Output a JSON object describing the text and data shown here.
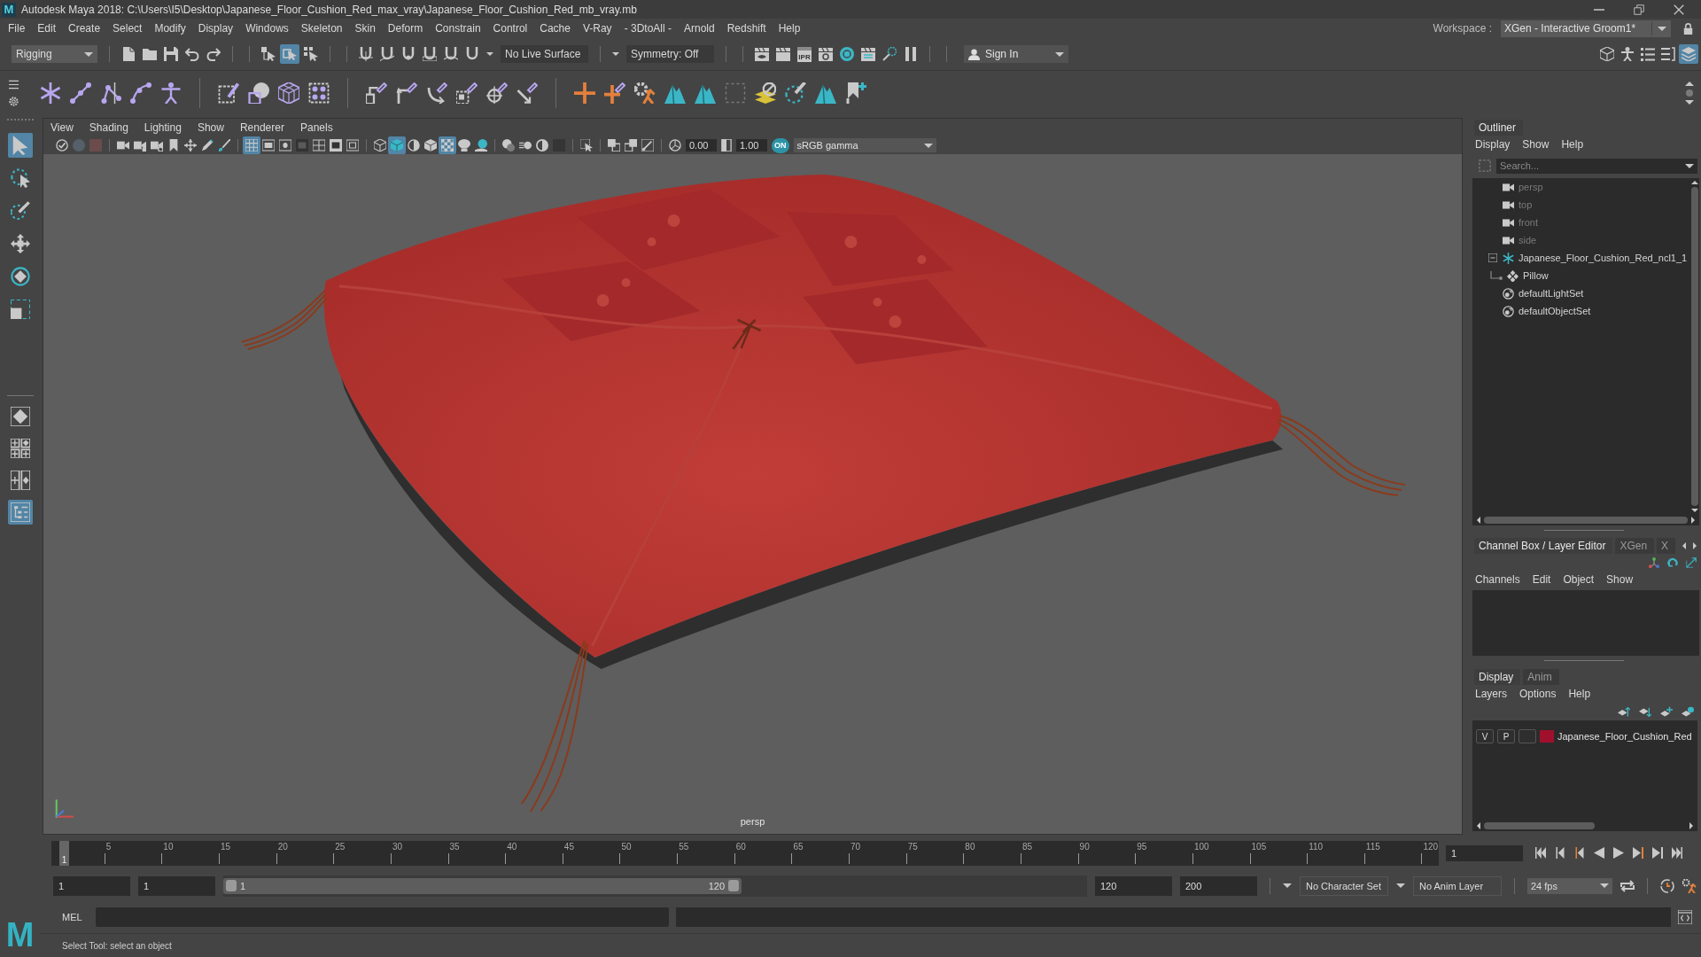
{
  "window": {
    "icon": "M",
    "title": "Autodesk Maya 2018: C:\\Users\\I5\\Desktop\\Japanese_Floor_Cushion_Red_max_vray\\Japanese_Floor_Cushion_Red_mb_vray.mb"
  },
  "menu_bar": [
    "File",
    "Edit",
    "Create",
    "Select",
    "Modify",
    "Display",
    "Windows",
    "Skeleton",
    "Skin",
    "Deform",
    "Constrain",
    "Control",
    "Cache",
    "V-Ray",
    "- 3DtoAll -",
    "Arnold",
    "Redshift",
    "Help"
  ],
  "workspace": {
    "label": "Workspace :",
    "value": "XGen - Interactive Groom1*"
  },
  "status_line": {
    "menu_set": "Rigging",
    "select_modes": [
      {
        "kind": "hierarchy",
        "on": false
      },
      {
        "kind": "object",
        "on": true
      },
      {
        "kind": "component",
        "on": false
      }
    ],
    "live_surface": "No Live Surface",
    "symmetry": "Symmetry: Off",
    "ipr_label": "IPR",
    "sign_in": "Sign In",
    "panels": [
      {
        "kind": "toolkit",
        "on": false
      },
      {
        "kind": "character",
        "on": false
      },
      {
        "kind": "attributes",
        "on": false
      },
      {
        "kind": "settings",
        "on": false
      },
      {
        "kind": "channels",
        "on": true
      }
    ]
  },
  "toolbox": {
    "tools": [
      {
        "kind": "select",
        "selected": true
      },
      {
        "kind": "lasso",
        "selected": false
      },
      {
        "kind": "paint",
        "selected": false
      },
      {
        "kind": "move",
        "selected": false
      },
      {
        "kind": "rotate",
        "selected": false
      },
      {
        "kind": "scale",
        "selected": false
      }
    ],
    "layouts": [
      {
        "kind": "single",
        "on": false
      },
      {
        "kind": "four",
        "on": false
      },
      {
        "kind": "two",
        "on": false
      },
      {
        "kind": "outliner",
        "on": true
      }
    ]
  },
  "viewport": {
    "menus": [
      "View",
      "Shading",
      "Lighting",
      "Show",
      "Renderer",
      "Panels"
    ],
    "toolbar": [
      [
        {
          "kind": "camsel",
          "on": false
        },
        {
          "kind": "lockdim",
          "on": false
        },
        {
          "kind": "dimsq",
          "on": false
        }
      ],
      [
        {
          "kind": "camera",
          "on": false
        },
        {
          "kind": "camlock",
          "on": false
        },
        {
          "kind": "camattr",
          "on": false
        },
        {
          "kind": "bookmark",
          "on": false
        },
        {
          "kind": "pan",
          "on": false
        },
        {
          "kind": "pencil",
          "on": false
        },
        {
          "kind": "brush",
          "on": false
        }
      ],
      [
        {
          "kind": "grid",
          "on": true
        },
        {
          "kind": "filmgate",
          "on": false
        },
        {
          "kind": "resgate",
          "on": false
        },
        {
          "kind": "gatemask",
          "on": false
        },
        {
          "kind": "fieldchart",
          "on": false
        },
        {
          "kind": "safeaction",
          "on": false
        },
        {
          "kind": "safetitle",
          "on": false
        }
      ],
      [
        {
          "kind": "wire",
          "on": false
        },
        {
          "kind": "smooth",
          "on": true
        },
        {
          "kind": "half",
          "on": false
        },
        {
          "kind": "flat",
          "on": false
        },
        {
          "kind": "checker",
          "on": true
        },
        {
          "kind": "bulb",
          "on": false
        },
        {
          "kind": "shadow",
          "on": false
        }
      ],
      [
        {
          "kind": "ao",
          "on": false
        },
        {
          "kind": "mblur",
          "on": false
        },
        {
          "kind": "aa",
          "on": false
        },
        {
          "kind": "darksq",
          "on": false
        }
      ],
      [
        {
          "kind": "isolate",
          "on": false
        }
      ],
      [
        {
          "kind": "xray",
          "on": false
        },
        {
          "kind": "xrayact",
          "on": false
        },
        {
          "kind": "xrayjoint",
          "on": false
        }
      ]
    ],
    "exposure": "0.00",
    "gamma": "1.00",
    "color_management": {
      "label": "ON",
      "on": true
    },
    "color_space": "sRGB gamma",
    "camera": "persp"
  },
  "outliner": {
    "title": "Outliner",
    "menus": [
      "Display",
      "Show",
      "Help"
    ],
    "search": {
      "placeholder": "Search..."
    },
    "items": [
      {
        "label": "persp",
        "kind": "camera",
        "dimmed": true
      },
      {
        "label": "top",
        "kind": "camera",
        "dimmed": true
      },
      {
        "label": "front",
        "kind": "camera",
        "dimmed": true
      },
      {
        "label": "side",
        "kind": "camera",
        "dimmed": true
      },
      {
        "label": "Japanese_Floor_Cushion_Red_ncl1_1",
        "kind": "group",
        "dimmed": false,
        "expanded": true,
        "children": [
          {
            "label": "Pillow",
            "kind": "mesh",
            "dimmed": false
          }
        ]
      },
      {
        "label": "defaultLightSet",
        "kind": "set",
        "dimmed": false
      },
      {
        "label": "defaultObjectSet",
        "kind": "set",
        "dimmed": false
      }
    ]
  },
  "channel_box": {
    "tabs": [
      {
        "label": "Channel Box / Layer Editor",
        "selected": true
      },
      {
        "label": "XGen",
        "selected": false
      },
      {
        "label": "X",
        "selected": false
      }
    ],
    "menus": [
      "Channels",
      "Edit",
      "Object",
      "Show"
    ]
  },
  "layer_editor": {
    "tabs": [
      {
        "label": "Display",
        "selected": true
      },
      {
        "label": "Anim",
        "selected": false
      }
    ],
    "menus": [
      "Layers",
      "Options",
      "Help"
    ],
    "layers": [
      {
        "visibility": "V",
        "playback": "P",
        "name": "Japanese_Floor_Cushion_Red",
        "color": "#a0102c"
      }
    ]
  },
  "timeline": {
    "marker": "1",
    "level": 0,
    "ticks": [
      "5",
      "10",
      "15",
      "20",
      "25",
      "30",
      "35",
      "40",
      "45",
      "50",
      "55",
      "60",
      "65",
      "70",
      "75",
      "80",
      "85",
      "90",
      "95",
      "100",
      "105",
      "110",
      "115",
      "120"
    ],
    "current_frame": "1"
  },
  "range": {
    "start": "1",
    "playback_start": "1",
    "slider": {
      "start": "1",
      "end": "120",
      "level": 0.6
    },
    "playback_end": "120",
    "end": "200",
    "character_set": "No Character Set",
    "anim_layer": "No Anim Layer",
    "fps": "24 fps"
  },
  "command_line": {
    "language": "MEL"
  },
  "help_line": "Select Tool: select an object",
  "logo": "M"
}
